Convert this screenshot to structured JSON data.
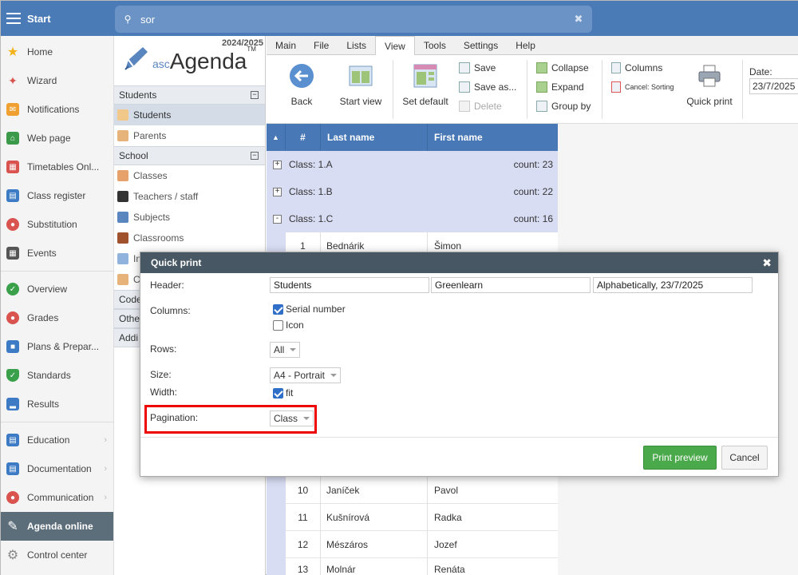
{
  "topbar": {
    "start_label": "Start",
    "search_value": "sor"
  },
  "nav": {
    "items": [
      {
        "label": "Home"
      },
      {
        "label": "Wizard"
      },
      {
        "label": "Notifications"
      },
      {
        "label": "Web page"
      },
      {
        "label": "Timetables Onl..."
      },
      {
        "label": "Class register"
      },
      {
        "label": "Substitution"
      },
      {
        "label": "Events"
      },
      {
        "label": "Overview"
      },
      {
        "label": "Grades"
      },
      {
        "label": "Plans & Prepar..."
      },
      {
        "label": "Standards"
      },
      {
        "label": "Results"
      },
      {
        "label": "Education"
      },
      {
        "label": "Documentation"
      },
      {
        "label": "Communication"
      },
      {
        "label": "Agenda online"
      },
      {
        "label": "Control center"
      }
    ]
  },
  "col2": {
    "year": "2024/2025",
    "logo_asc": "asc",
    "logo_agenda": "Agenda",
    "logo_tm": "TM",
    "groups": {
      "students": "Students",
      "school": "School",
      "codes": "Code",
      "other": "Othe",
      "additional": "Addi"
    },
    "items": {
      "students": "Students",
      "parents": "Parents",
      "classes": "Classes",
      "teachers": "Teachers / staff",
      "subjects": "Subjects",
      "classrooms": "Classrooms",
      "item_in": "In",
      "item_c": "C"
    }
  },
  "menu": {
    "tabs": [
      "Main",
      "File",
      "Lists",
      "View",
      "Tools",
      "Settings",
      "Help"
    ]
  },
  "ribbon": {
    "back": "Back",
    "start_view": "Start view",
    "set_default": "Set default",
    "save": "Save",
    "save_as": "Save as...",
    "delete": "Delete",
    "collapse": "Collapse",
    "expand": "Expand",
    "group_by": "Group by",
    "columns": "Columns",
    "cancel_sorting": "Cancel: Sorting",
    "quick_print": "Quick print",
    "date_label": "Date:",
    "date_value": "23/7/2025"
  },
  "grid": {
    "headers": [
      "#",
      "Last name",
      "First name"
    ],
    "classes": [
      {
        "label": "Class: 1.A",
        "count": "count: 23",
        "state": "+"
      },
      {
        "label": "Class: 1.B",
        "count": "count: 22",
        "state": "+"
      },
      {
        "label": "Class: 1.C",
        "count": "count: 16",
        "state": "-"
      }
    ],
    "rows_top": [
      {
        "n": "1",
        "last": "Bednárik",
        "first": "Šimon"
      }
    ],
    "rows_bottom": [
      {
        "n": "10",
        "last": "Janíček",
        "first": "Pavol"
      },
      {
        "n": "11",
        "last": "Kušnírová",
        "first": "Radka"
      },
      {
        "n": "12",
        "last": "Mészáros",
        "first": "Jozef"
      },
      {
        "n": "13",
        "last": "Molnár",
        "first": "Renáta"
      }
    ]
  },
  "modal": {
    "title": "Quick print",
    "header_label": "Header:",
    "header_values": [
      "Students",
      "Greenlearn",
      "Alphabetically, 23/7/2025"
    ],
    "columns_label": "Columns:",
    "col_serial": "Serial number",
    "col_icon": "Icon",
    "rows_label": "Rows:",
    "rows_value": "All",
    "size_label": "Size:",
    "size_value": "A4 - Portrait",
    "width_label": "Width:",
    "width_fit": "fit",
    "pagination_label": "Pagination:",
    "pagination_value": "Class",
    "print_preview": "Print preview",
    "cancel": "Cancel"
  }
}
